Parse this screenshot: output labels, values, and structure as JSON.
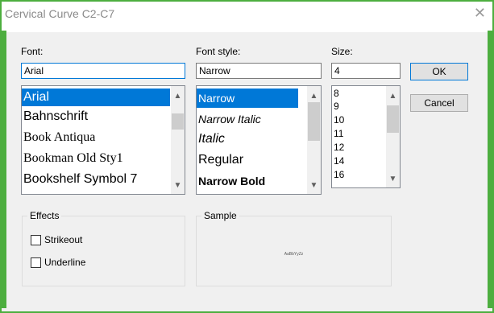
{
  "window": {
    "title": "Cervical Curve C2-C7",
    "close_glyph": "✕"
  },
  "font": {
    "label": "Font:",
    "value": "Arial",
    "items": [
      "Arial",
      "Bahnschrift",
      "Book Antiqua",
      "Bookman Old Sty1",
      "Bookshelf Symbol 7"
    ],
    "selected": "Arial"
  },
  "style": {
    "label": "Font style:",
    "value": "Narrow",
    "items": [
      "Narrow",
      "Narrow Italic",
      "Italic",
      "Regular",
      "Narrow Bold"
    ],
    "selected": "Narrow"
  },
  "size": {
    "label": "Size:",
    "value": "4",
    "items": [
      "8",
      "9",
      "10",
      "11",
      "12",
      "14",
      "16"
    ]
  },
  "buttons": {
    "ok": "OK",
    "cancel": "Cancel"
  },
  "effects": {
    "label": "Effects",
    "strikeout": "Strikeout",
    "underline": "Underline"
  },
  "sample": {
    "label": "Sample",
    "text": "AaBbYyZz"
  },
  "colors": {
    "accent": "#0078d7",
    "frame": "#4dae3f"
  }
}
